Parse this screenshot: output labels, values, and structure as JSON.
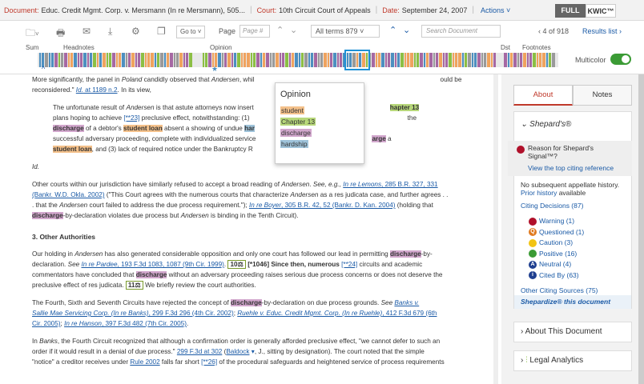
{
  "topbar": {
    "document_key": "Document:",
    "document_value": "Educ. Credit Mgmt. Corp. v. Mersmann (In re Mersmann), 505...",
    "court_key": "Court:",
    "court_value": "10th Circuit Court of Appeals",
    "date_key": "Date:",
    "date_value": "September 24, 2007",
    "actions_label": "Actions",
    "full_label": "FULL",
    "kwic_label": "KWIC™"
  },
  "toolbar": {
    "goto_label": "Go to",
    "page_label": "Page",
    "page_placeholder": "Page #",
    "allterms_label": "All terms",
    "allterms_count": "879",
    "search_placeholder": "Search Document",
    "page_count": "4 of 918",
    "results_list": "Results list"
  },
  "heatmap_labels": {
    "sum": "Sum",
    "headnotes": "Headnotes",
    "opinion": "Opinion",
    "dst": "Dst",
    "footnotes": "Footnotes",
    "multicolor": "Multicolor"
  },
  "heatmap": {
    "colors": {
      "orange": "#f0a35e",
      "green": "#8cbf44",
      "purple": "#a668a3",
      "blue": "#4d8fc0",
      "gray": "#9a9a9a"
    },
    "multicolor_on": true
  },
  "popup": {
    "title": "Opinion",
    "terms": [
      "student",
      "Chapter 13",
      "discharge",
      "hardship"
    ]
  },
  "doc": {
    "p1": {
      "a": "More significantly, the panel in ",
      "b": "Poland",
      "c": " candidly observed that ",
      "d": "Andersen",
      "e": ", whil",
      "f": "ould be",
      "g": "reconsidered.\"",
      "h": "Id.",
      "i": " at 1189 n.2",
      "j": ". In its view,"
    },
    "q1": {
      "a": "The unfortunate result of ",
      "b": "Andersen",
      "c": " is that astute attorneys now insert",
      "d": "hapter 13",
      "e": "plans hoping to achieve",
      "f": "[**23]",
      "g": " preclusive effect, notwithstanding: (1)",
      "h": "the",
      "i": "discharge",
      "j": " of a debtor's ",
      "k": "student loan",
      "l": " absent a showing of undue ",
      "m": "har",
      "n": "successful adversary proceeding, complete with individualized service",
      "o": "arge",
      "p": " a",
      "q": "student loan",
      "r": ", and (3) lack of required notice under the Bankruptcy R"
    },
    "id": "Id.",
    "p2": {
      "a": "Other courts within our jurisdiction have similarly refused to accept a broad reading of ",
      "b": "Andersen",
      "c": ". ",
      "d": "See, e.g.,",
      "e": " ",
      "f": "In re Lemons",
      "g": ", 285 B.R. 327, 331",
      "h": "(Bankr. W.D. Okla. 2002)",
      "i": " (\"This Court agrees with the numerous courts that characterize ",
      "j": "Andersen",
      "k": " as a res judicata case, and further agrees . .",
      "l": ". that the ",
      "m": "Andersen",
      "n": " court failed to address the due process requirement.\"); ",
      "o": "In re Boyer",
      "p": ", 305 B.R. 42, 52 (Bankr. D. Kan. 2004)",
      "q": " (holding that",
      "r": "discharge",
      "s": "-by-declaration violates due process but ",
      "t": "Andersen",
      "u": " is binding in the Tenth Circuit)."
    },
    "h3": "3. Other Authorities",
    "p3": {
      "a": "Our holding in ",
      "b": "Andersen",
      "c": " has also generated considerable opposition and only one court has followed our lead in permitting ",
      "d": "discharge",
      "e": "-by-",
      "f": "declaration. ",
      "g": "See",
      "h": " ",
      "i": "In re Pardee",
      "j": ", 193 F.3d 1083, 1087 (9th Cir. 1999)",
      "k": ". ",
      "l": "10",
      "m": " [*1046] Since then, numerous ",
      "n": "[**24]",
      "o": " circuits and academic",
      "p": "commentators have concluded that ",
      "q": "discharge",
      "r": " without an adversary proceeding raises serious due process concerns or does not deserve the",
      "s": "preclusive effect of res judicata. ",
      "t": "11",
      "u": " We briefly review the court authorities."
    },
    "p4": {
      "a": "The Fourth, Sixth and Seventh Circuits have rejected the concept of ",
      "b": "discharge",
      "c": "-by-declaration on due process grounds. ",
      "d": "See",
      "e": " ",
      "f": "Banks v.",
      "g": "Sallie Mae Servicing Corp. (In re Banks)",
      "h": ", 299 F.3d 296 (4th Cir. 2002)",
      "i": "; ",
      "j": "Ruehle v. Educ. Credit Mgmt. Corp. (In re Ruehle)",
      "k": ", 412 F.3d 679 (6th",
      "l": "Cir. 2005)",
      "m": "; ",
      "n": "In re Hanson",
      "o": ", 397 F.3d 482 (7th Cir. 2005)",
      "p": "."
    },
    "p5": {
      "a": "In ",
      "b": "Banks",
      "c": ", the Fourth Circuit recognized that although a confirmation order is generally afforded preclusive effect, \"we cannot defer to such an",
      "d": "order if it would result in a denial of due process.\" ",
      "e": "299 F.3d at 302",
      "f": " (",
      "g": "Baldock",
      "h": ", J., sitting by designation). The court noted that the simple",
      "i": "\"notice\" a creditor receives under ",
      "j": "Rule 2002",
      "k": " falls far short ",
      "l": "[**26]",
      "m": " of the procedural safeguards and heightened service of process requirements"
    }
  },
  "sidebar": {
    "tab_about": "About",
    "tab_notes": "Notes",
    "shepards": "Shepard's®",
    "reason_text": "Reason for Shepard's Signal™?",
    "reason_link": "View the top citing reference",
    "no_sub": "No subsequent appellate history. ",
    "prior_history": "Prior history",
    "available": " available",
    "citing_decisions": "Citing Decisions (87)",
    "signals": [
      {
        "label": "Warning (1)",
        "color": "#b0102a",
        "glyph": ""
      },
      {
        "label": "Questioned (1)",
        "color": "#e07a1f",
        "glyph": "Q"
      },
      {
        "label": "Caution (3)",
        "color": "#f2c414",
        "glyph": ""
      },
      {
        "label": "Positive (16)",
        "color": "#3b9b35",
        "glyph": ""
      },
      {
        "label": "Neutral (4)",
        "color": "#1f3f8f",
        "glyph": "A"
      },
      {
        "label": "Cited By (63)",
        "color": "#1f3f8f",
        "glyph": "i"
      }
    ],
    "other_sources": "Other Citing Sources (75)",
    "shepardize": "Shepardize® this document",
    "about_doc": "About This Document",
    "legal_analytics": "Legal Analytics"
  }
}
